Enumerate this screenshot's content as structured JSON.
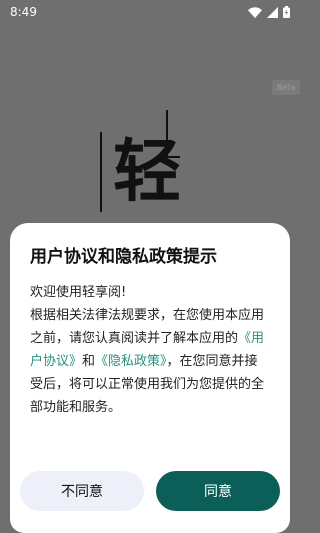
{
  "status_bar": {
    "time": "8:49"
  },
  "beta_label": "Beta",
  "logo": {
    "char": "轻"
  },
  "dialog": {
    "title": "用户协议和隐私政策提示",
    "welcome": "欢迎使用轻享阅!",
    "intro": "根据相关法律法规要求，在您使用本应用之前，请您认真阅读并了解本应用的",
    "user_agreement_link": "《用户协议》",
    "and_text": "和",
    "privacy_policy_link": "《隐私政策》",
    "outro": "，在您同意并接受后，将可以正常使用我们为您提供的全部功能和服务。"
  },
  "buttons": {
    "decline_label": "不同意",
    "accept_label": "同意"
  },
  "colors": {
    "overlay_background": "#6f6f6f",
    "link": "#2b8f80",
    "accept_button": "#0c5e58",
    "decline_button": "#eef0f9"
  },
  "icons": {
    "wifi": "wifi-icon",
    "cellular": "cellular-signal-icon",
    "battery": "battery-icon"
  }
}
